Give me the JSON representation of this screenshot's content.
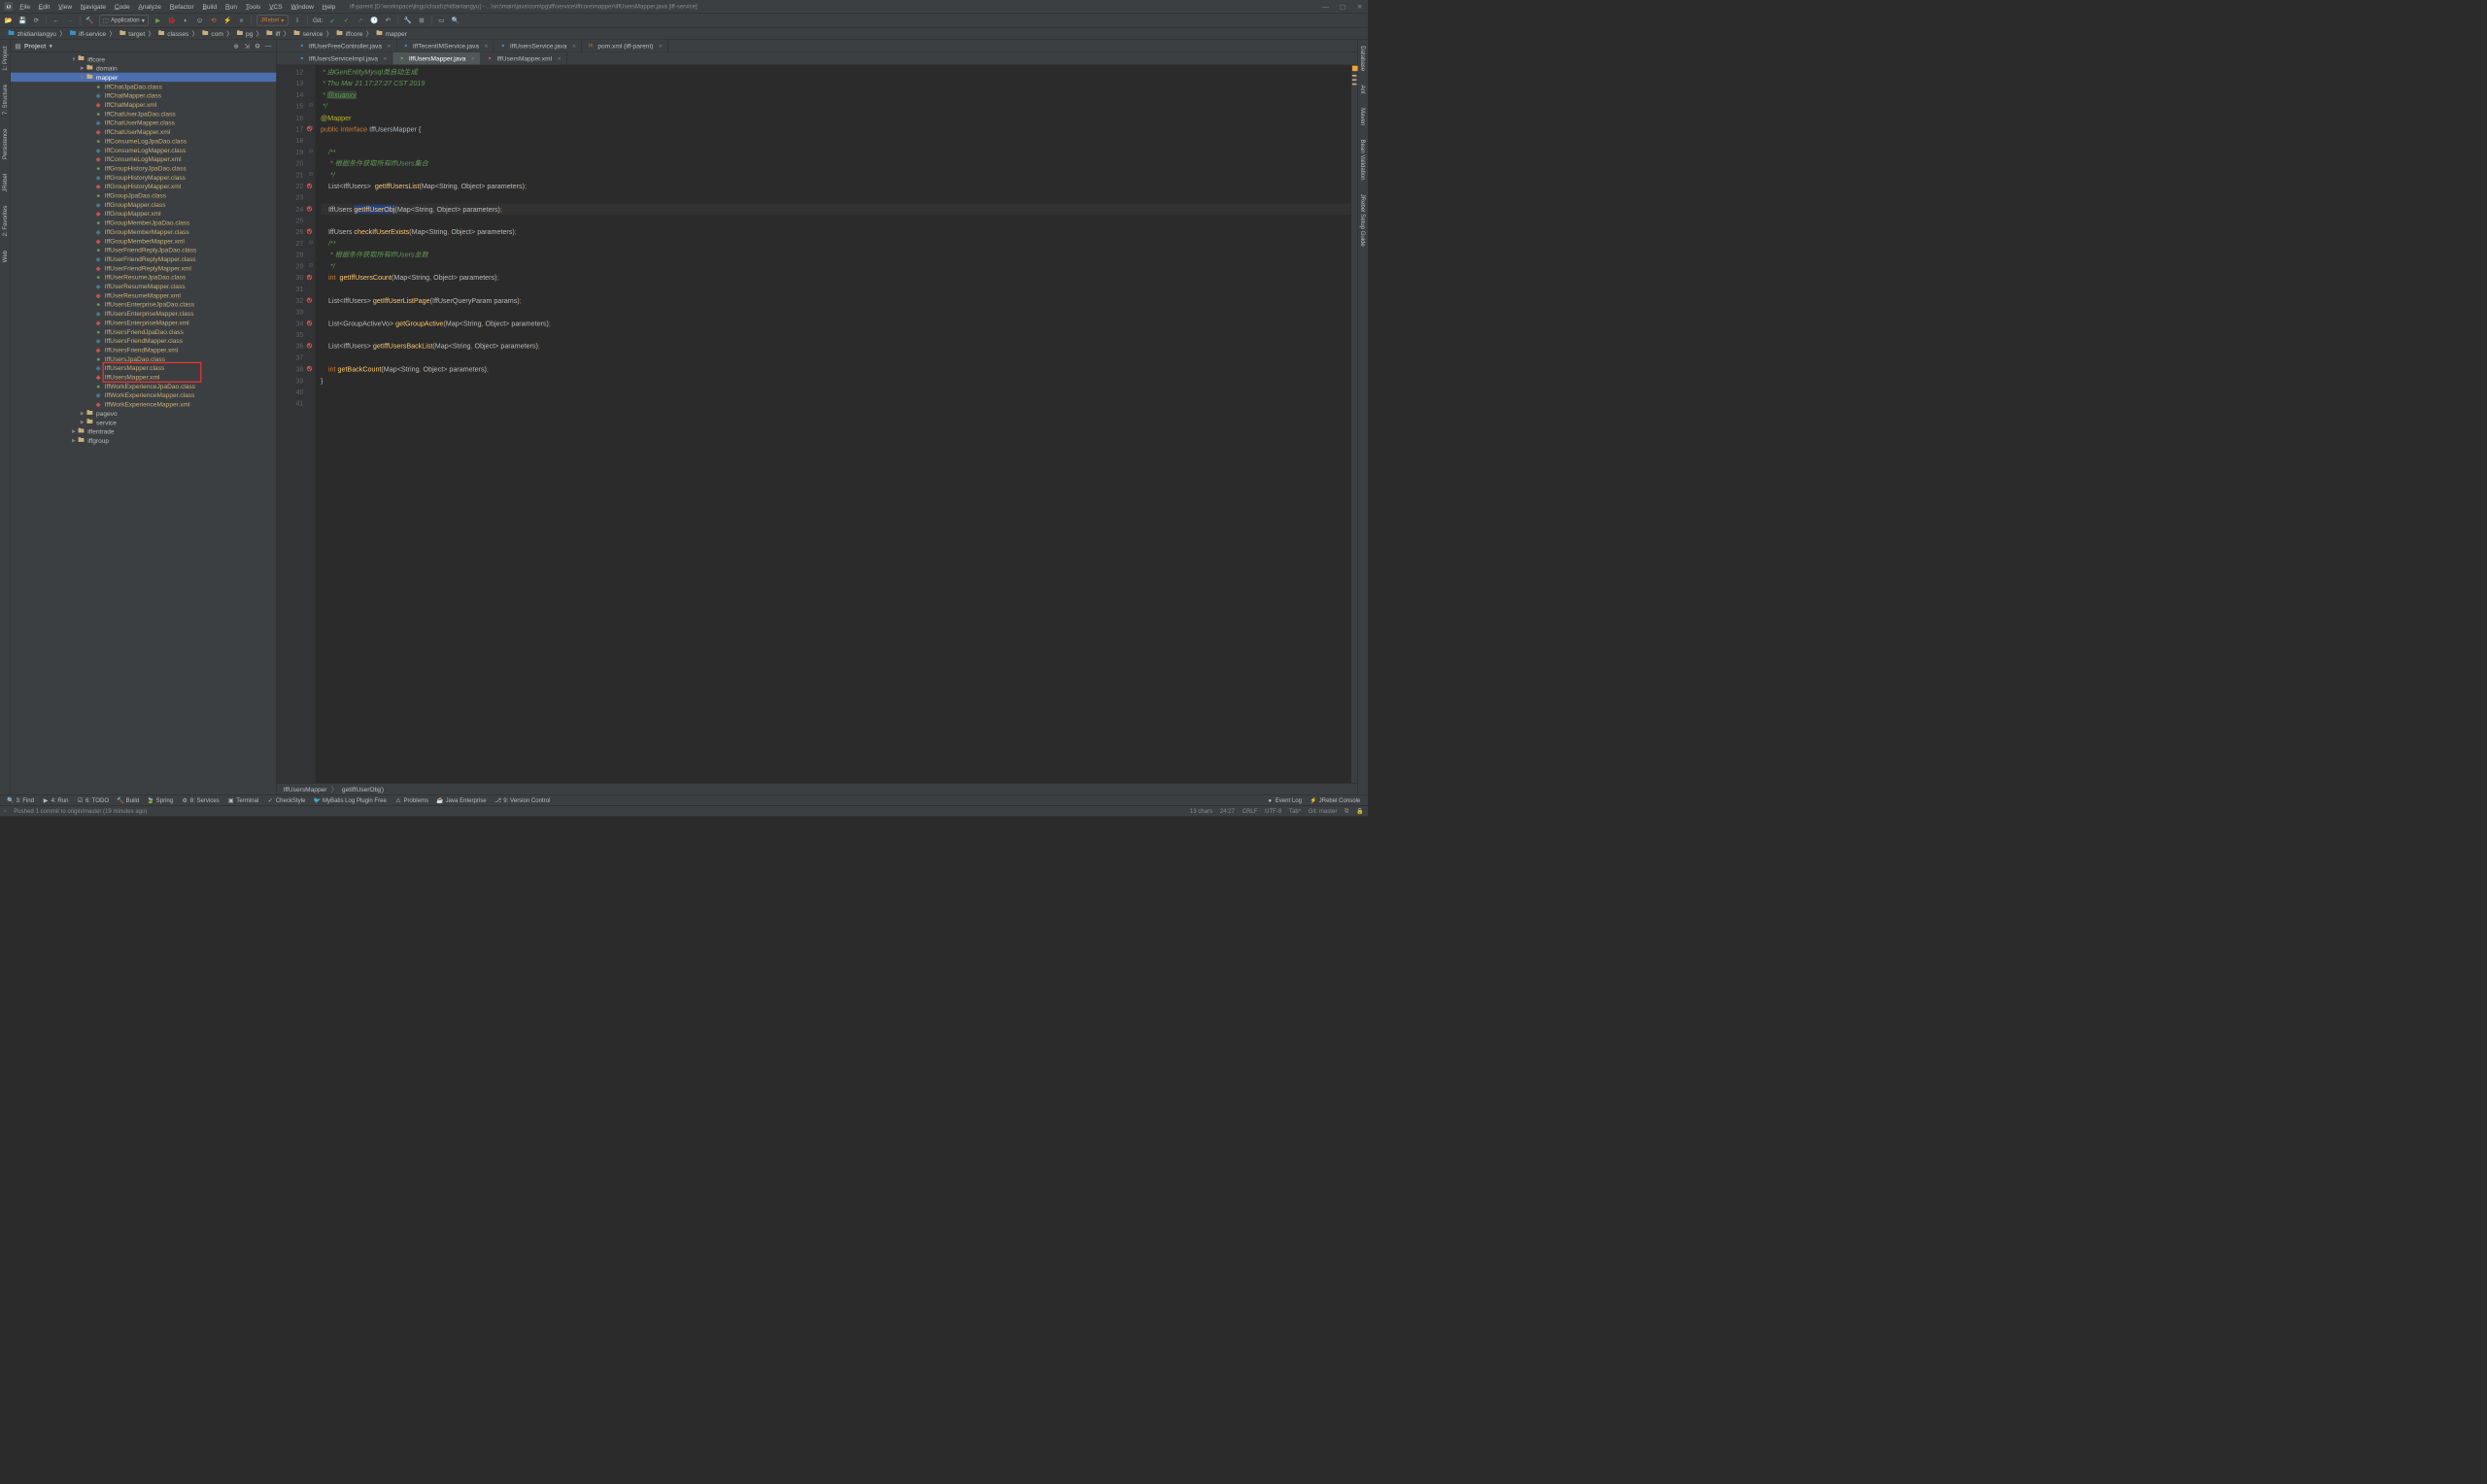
{
  "title": "iff-parent [D:\\workspace\\jingu\\cloud\\zhidianlangyu] - ...\\src\\main\\java\\com\\pg\\iff\\service\\iffcore\\mapper\\IffUsersMapper.java [iff-service]",
  "menus": [
    "File",
    "Edit",
    "View",
    "Navigate",
    "Code",
    "Analyze",
    "Refactor",
    "Build",
    "Run",
    "Tools",
    "VCS",
    "Window",
    "Help"
  ],
  "toolbar": {
    "runconfig": "Application",
    "jrebel": "JRebel",
    "git": "Git:"
  },
  "breadcrumb": [
    {
      "icon": "folder-blue",
      "label": "zhidianlangyu"
    },
    {
      "icon": "folder-blue",
      "label": "iff-service"
    },
    {
      "icon": "folder-orange",
      "label": "target"
    },
    {
      "icon": "folder-orange",
      "label": "classes"
    },
    {
      "icon": "folder-orange",
      "label": "com"
    },
    {
      "icon": "folder-orange",
      "label": "pg"
    },
    {
      "icon": "folder-orange",
      "label": "iff"
    },
    {
      "icon": "folder-orange",
      "label": "service"
    },
    {
      "icon": "folder-orange",
      "label": "iffcore"
    },
    {
      "icon": "folder-orange",
      "label": "mapper"
    }
  ],
  "project_label": "Project",
  "tree": [
    {
      "depth": 7,
      "arrow": "▼",
      "type": "folder",
      "label": "iffcore"
    },
    {
      "depth": 8,
      "arrow": "▶",
      "type": "folder",
      "label": "domain"
    },
    {
      "depth": 8,
      "arrow": "▼",
      "type": "folder",
      "label": "mapper",
      "selected": true
    },
    {
      "depth": 9,
      "type": "iface",
      "label": "IffChatJpaDao.class"
    },
    {
      "depth": 9,
      "type": "class",
      "label": "IffChatMapper.class"
    },
    {
      "depth": 9,
      "type": "xml",
      "label": "IffChatMapper.xml"
    },
    {
      "depth": 9,
      "type": "iface",
      "label": "IffChatUserJpaDao.class"
    },
    {
      "depth": 9,
      "type": "class",
      "label": "IffChatUserMapper.class"
    },
    {
      "depth": 9,
      "type": "xml",
      "label": "IffChatUserMapper.xml"
    },
    {
      "depth": 9,
      "type": "iface",
      "label": "IffConsumeLogJpaDao.class"
    },
    {
      "depth": 9,
      "type": "class",
      "label": "IffConsumeLogMapper.class"
    },
    {
      "depth": 9,
      "type": "xml",
      "label": "IffConsumeLogMapper.xml"
    },
    {
      "depth": 9,
      "type": "iface",
      "label": "IffGroupHistoryJpaDao.class"
    },
    {
      "depth": 9,
      "type": "class",
      "label": "IffGroupHistoryMapper.class"
    },
    {
      "depth": 9,
      "type": "xml",
      "label": "IffGroupHistoryMapper.xml"
    },
    {
      "depth": 9,
      "type": "iface",
      "label": "IffGroupJpaDao.class"
    },
    {
      "depth": 9,
      "type": "class",
      "label": "IffGroupMapper.class"
    },
    {
      "depth": 9,
      "type": "xml",
      "label": "IffGroupMapper.xml"
    },
    {
      "depth": 9,
      "type": "iface",
      "label": "IffGroupMemberJpaDao.class"
    },
    {
      "depth": 9,
      "type": "class",
      "label": "IffGroupMemberMapper.class"
    },
    {
      "depth": 9,
      "type": "xml",
      "label": "IffGroupMemberMapper.xml"
    },
    {
      "depth": 9,
      "type": "iface",
      "label": "IffUserFriendReplyJpaDao.class"
    },
    {
      "depth": 9,
      "type": "class",
      "label": "IffUserFriendReplyMapper.class"
    },
    {
      "depth": 9,
      "type": "xml",
      "label": "IffUserFriendReplyMapper.xml"
    },
    {
      "depth": 9,
      "type": "iface",
      "label": "IffUserResumeJpaDao.class"
    },
    {
      "depth": 9,
      "type": "class",
      "label": "IffUserResumeMapper.class"
    },
    {
      "depth": 9,
      "type": "xml",
      "label": "IffUserResumeMapper.xml"
    },
    {
      "depth": 9,
      "type": "iface",
      "label": "IffUsersEnterpriseJpaDao.class"
    },
    {
      "depth": 9,
      "type": "class",
      "label": "IffUsersEnterpriseMapper.class"
    },
    {
      "depth": 9,
      "type": "xml",
      "label": "IffUsersEnterpriseMapper.xml"
    },
    {
      "depth": 9,
      "type": "iface",
      "label": "IffUsersFriendJpaDao.class"
    },
    {
      "depth": 9,
      "type": "class",
      "label": "IffUsersFriendMapper.class"
    },
    {
      "depth": 9,
      "type": "xml",
      "label": "IffUsersFriendMapper.xml"
    },
    {
      "depth": 9,
      "type": "iface",
      "label": "IffUsersJpaDao.class"
    },
    {
      "depth": 9,
      "type": "class",
      "label": "IffUsersMapper.class",
      "boxed": true
    },
    {
      "depth": 9,
      "type": "xml",
      "label": "IffUsersMapper.xml",
      "boxed": true
    },
    {
      "depth": 9,
      "type": "iface",
      "label": "IffWorkExperienceJpaDao.class"
    },
    {
      "depth": 9,
      "type": "class",
      "label": "IffWorkExperienceMapper.class"
    },
    {
      "depth": 9,
      "type": "xml",
      "label": "IffWorkExperienceMapper.xml"
    },
    {
      "depth": 8,
      "arrow": "▶",
      "type": "folder",
      "label": "pagevo"
    },
    {
      "depth": 8,
      "arrow": "▶",
      "type": "folder",
      "label": "service"
    },
    {
      "depth": 7,
      "arrow": "▶",
      "type": "folder",
      "label": "iffentrade"
    },
    {
      "depth": 7,
      "arrow": "▶",
      "type": "folder",
      "label": "iffgroup"
    }
  ],
  "tabs_row1": [
    {
      "icon": "class",
      "label": "IffUserFreeController.java"
    },
    {
      "icon": "class",
      "label": "IffTecentIMService.java"
    },
    {
      "icon": "class",
      "label": "IffUsersService.java"
    },
    {
      "icon": "maven",
      "label": "pom.xml (iff-parent)"
    }
  ],
  "tabs_row2": [
    {
      "icon": "class",
      "label": "IffUsersServiceImpl.java"
    },
    {
      "icon": "iface",
      "label": "IffUsersMapper.java",
      "active": true
    },
    {
      "icon": "xml",
      "label": "IffUsersMapper.xml"
    }
  ],
  "code": {
    "start": 12,
    "lines": [
      {
        "n": 12,
        "html": " <span class='c-doc'>* 由GenEntityMysql类自动生成</span>"
      },
      {
        "n": 13,
        "html": " <span class='c-doc'>* Thu Mar 21 17:27:27 CST 2019</span>"
      },
      {
        "n": 14,
        "html": " <span class='c-doc'>* <span class='c-doctag' style='background:#344134'>@xuanxy</span></span>"
      },
      {
        "n": 15,
        "html": " <span class='c-doc'>*/</span>",
        "fold": "⊟"
      },
      {
        "n": 16,
        "html": "<span class='c-anno'>@Mapper</span>"
      },
      {
        "n": 17,
        "html": "<span class='c-kw'>public interface</span> <span class='c-type'>IffUsersMapper</span> {",
        "mark": "impl",
        "fold": "⊟"
      },
      {
        "n": 18,
        "html": ""
      },
      {
        "n": 19,
        "html": "    <span class='c-doc'>/**</span>",
        "fold": "⊟"
      },
      {
        "n": 20,
        "html": "    <span class='c-doc'> * 根据条件获取所有IffUsers集合</span>"
      },
      {
        "n": 21,
        "html": "    <span class='c-doc'> */</span>",
        "fold": "⊟"
      },
      {
        "n": 22,
        "html": "    List&lt;IffUsers&gt;  <span class='c-ident'>getIffUsersList</span>(Map&lt;String<span class='c-kw'>,</span> Object&gt; parameters)<span class='c-kw'>;</span>",
        "mark": "impl"
      },
      {
        "n": 23,
        "html": ""
      },
      {
        "n": 24,
        "html": "    IffUsers <span class='c-ident sel'>getIffUserObj</span>(Map&lt;String<span class='c-kw'>,</span> Object&gt; parameters)<span class='c-kw'>;</span>",
        "mark": "impl",
        "current": true
      },
      {
        "n": 25,
        "html": ""
      },
      {
        "n": 26,
        "html": "    IffUsers <span class='c-ident'>checkIfUserExists</span>(Map&lt;String<span class='c-kw'>,</span> Object&gt; parameters)<span class='c-kw'>;</span>",
        "mark": "impl"
      },
      {
        "n": 27,
        "html": "    <span class='c-doc'>/**</span>",
        "fold": "⊟"
      },
      {
        "n": 28,
        "html": "    <span class='c-doc'> * 根据条件获取所有IffUsers总数</span>"
      },
      {
        "n": 29,
        "html": "    <span class='c-doc'> */</span>",
        "fold": "⊟"
      },
      {
        "n": 30,
        "html": "    <span class='c-kw'>int</span>  <span class='c-ident'>getIffUsersCount</span>(Map&lt;String<span class='c-kw'>,</span> Object&gt; parameters)<span class='c-kw'>;</span>",
        "mark": "impl"
      },
      {
        "n": 31,
        "html": ""
      },
      {
        "n": 32,
        "html": "    List&lt;IffUsers&gt; <span class='c-ident'>getIffUserListPage</span>(IffUserQueryParam params)<span class='c-kw'>;</span>",
        "mark": "impl"
      },
      {
        "n": 33,
        "html": ""
      },
      {
        "n": 34,
        "html": "    List&lt;GroupActiveVo&gt; <span class='c-ident'>getGroupActive</span>(Map&lt;String<span class='c-kw'>,</span> Object&gt; parameters)<span class='c-kw'>;</span>",
        "mark": "impl"
      },
      {
        "n": 35,
        "html": ""
      },
      {
        "n": 36,
        "html": "    List&lt;IffUsers&gt; <span class='c-ident'>getIffUsersBackList</span>(Map&lt;String<span class='c-kw'>,</span> Object&gt; parameters)<span class='c-kw'>;</span>",
        "mark": "impl"
      },
      {
        "n": 37,
        "html": ""
      },
      {
        "n": 38,
        "html": "    <span class='c-kw'>int</span> <span class='c-ident'>getBackCount</span>(Map&lt;String<span class='c-kw'>,</span> Object&gt; parameters)<span class='c-kw'>;</span>",
        "mark": "impl"
      },
      {
        "n": 39,
        "html": "}"
      },
      {
        "n": 40,
        "html": ""
      },
      {
        "n": 41,
        "html": ""
      }
    ]
  },
  "editor_breadcrumb": [
    "IffUsersMapper",
    "getIffUserObj()"
  ],
  "left_tabs": [
    "1: Project",
    "7: Structure",
    "Persistence",
    "JRebel",
    "2: Favorites",
    "Web"
  ],
  "right_tabs": [
    "Database",
    "Ant",
    "Maven",
    "Bean Validation",
    "JRebel Setup Guide"
  ],
  "bottom_tabs": [
    {
      "icon": "🔍",
      "label": "3: Find"
    },
    {
      "icon": "▶",
      "label": "4: Run"
    },
    {
      "icon": "☑",
      "label": "6: TODO"
    },
    {
      "icon": "🔨",
      "label": "Build"
    },
    {
      "icon": "🍃",
      "label": "Spring"
    },
    {
      "icon": "⚙",
      "label": "8: Services"
    },
    {
      "icon": "▣",
      "label": "Terminal"
    },
    {
      "icon": "✓",
      "label": "CheckStyle"
    },
    {
      "icon": "🐦",
      "label": "MyBatis Log Plugin Free"
    },
    {
      "icon": "⚠",
      "label": "Problems"
    },
    {
      "icon": "☕",
      "label": "Java Enterprise"
    },
    {
      "icon": "⎇",
      "label": "9: Version Control"
    }
  ],
  "bottom_right": [
    {
      "icon": "●",
      "label": "Event Log"
    },
    {
      "icon": "⚡",
      "label": "JRebel Console"
    }
  ],
  "status": {
    "msg": "Pushed 1 commit to origin/master (19 minutes ago)",
    "chars": "13 chars",
    "pos": "24:27",
    "sep": "CRLF",
    "enc": "UTF-8",
    "tab": "Tab*",
    "git": "Git: master"
  }
}
